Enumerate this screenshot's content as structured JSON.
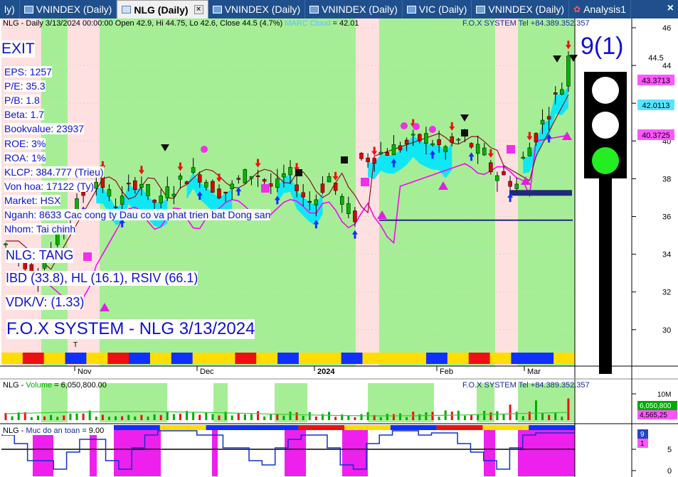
{
  "tabs": [
    {
      "label": "VNINDEX (Daily)",
      "active": false
    },
    {
      "label": "NLG (Daily)",
      "active": true
    },
    {
      "label": "VNINDEX (Daily)",
      "active": false
    },
    {
      "label": "VNINDEX (Daily)",
      "active": false
    },
    {
      "label": "VIC (Daily)",
      "active": false
    },
    {
      "label": "VNINDEX (Daily)",
      "active": false
    },
    {
      "label": "Analysis1",
      "active": false
    }
  ],
  "close_label": "×",
  "prefix_label": "ly)",
  "header": {
    "info": "NLG - Daily 3/13/2024 00:00:00 Open 42.9, Hi 44.75, Lo 42.6, Close 44.5 (4.7%)",
    "cloud": "MARC Cloud",
    "cloud_value": "= 42.01",
    "vendor": "F.O.X SYSTEM Tel +84.389.352.357"
  },
  "signal": {
    "label": "EXIT",
    "count": "9(1)"
  },
  "stats": [
    "EPS: 1257",
    "P/E: 35.3",
    "P/B: 1.8",
    "Beta: 1.7",
    "Bookvalue: 23937",
    "ROE: 3%",
    "ROA: 1%",
    "KLCP: 384.777 (Trieu)",
    "Von hoa: 17122 (Ty)",
    "Market: HSX",
    "Nganh: 8633 Cac cong ty Dau co va phat trien bat Dong san",
    "Nhom: Tai chinh"
  ],
  "trend": "NLG: TANG",
  "ratings": "IBD (33.8), HL (16.1), RSIV (66.1)",
  "vdk": "VDK/V:  (1.33)",
  "banner": "F.O.X SYSTEM - NLG 3/13/2024",
  "price_axis": {
    "ticks": [
      "46",
      "44",
      "42",
      "40",
      "38",
      "36",
      "34",
      "32",
      "30"
    ],
    "labels": [
      {
        "text": "44.5",
        "color": "#ffffff",
        "fg": "#000000"
      },
      {
        "text": "43.3713",
        "color": "#ff55ff",
        "fg": "#000000"
      },
      {
        "text": "42.0113",
        "color": "#55e6ff",
        "fg": "#000000"
      },
      {
        "text": "40.3725",
        "color": "#ff55ff",
        "fg": "#000000"
      }
    ]
  },
  "x_axis": {
    "labels": [
      "Nov",
      "Dec",
      "2024",
      "Feb",
      "Mar"
    ],
    "marker": "T"
  },
  "volume_panel": {
    "title": "NLG",
    "metric": "Volume",
    "value": "= 6,050,800.00",
    "vendor": "F.O.X SYSTEM Tel +84.389.352.357",
    "tick_top": "10M",
    "labels": [
      {
        "text": "6,050,800",
        "color": "#00aa00",
        "fg": "#ffffff"
      },
      {
        "text": "4,565,25",
        "color": "#ff55ff",
        "fg": "#000000"
      }
    ]
  },
  "safety_panel": {
    "title": "NLG",
    "metric": "Muc do an toan",
    "value": "= 9.00",
    "ticks": [
      "5",
      "0"
    ],
    "labels": [
      {
        "text": "9",
        "color": "#2244cc",
        "fg": "#ffffff"
      },
      {
        "text": "1",
        "color": "#ff55ff",
        "fg": "#000000"
      }
    ]
  },
  "colors": {
    "tab_bg": "#1f4f8c",
    "up_candle": "#00b400",
    "down_candle": "#e00000",
    "cloud_cyan": "#00e5ff",
    "ma_magenta": "#ff00ff",
    "green_zone": "#a6ee95",
    "pink_zone": "#ffe0e0",
    "navy": "#1f2a7a"
  }
}
